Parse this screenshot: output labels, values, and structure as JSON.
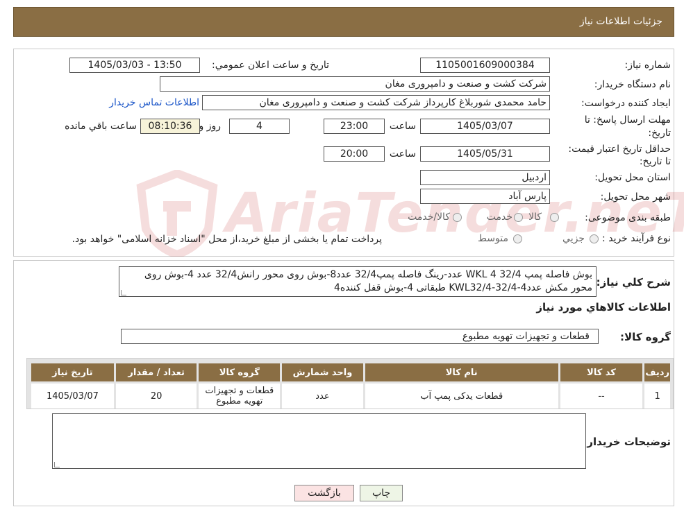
{
  "header": {
    "title": "جزئيات اطلاعات نياز"
  },
  "fields": {
    "need_number_label": "شماره نياز:",
    "need_number": "1105001609000384",
    "announce_label": "تاريخ و ساعت اعلان عمومي:",
    "announce_value": "1405/03/03 - 13:50",
    "buyer_org_label": "نام دستگاه خريدار:",
    "buyer_org": "شرکت کشت و صنعت و دامپروری مغان",
    "creator_label": "ايجاد کننده درخواست:",
    "creator": "حامد محمدی شوربلاغ کارپرداز شرکت کشت و صنعت و دامپروری مغان",
    "contact_link": "اطلاعات تماس خريدار",
    "deadline_label": "مهلت ارسال پاسخ: تا تاريخ:",
    "deadline_date": "1405/03/07",
    "time_label": "ساعت",
    "deadline_time": "23:00",
    "days_value": "4",
    "days_label": "روز و",
    "remaining_time": "08:10:36",
    "remaining_label": "ساعت باقي مانده",
    "validity_label": "حداقل تاريخ اعتبار قيمت: تا تاريخ:",
    "validity_date": "1405/05/31",
    "validity_time": "20:00",
    "province_label": "استان محل تحويل:",
    "province": "اردبيل",
    "city_label": "شهر محل تحويل:",
    "city": "پارس آباد",
    "category_label": "طبقه بندی موضوعی:",
    "category_options": [
      "کالا",
      "خدمت",
      "کالا/خدمت"
    ],
    "process_label": "نوع فرآيند خريد :",
    "process_options": [
      "جزيي",
      "متوسط"
    ],
    "process_note": "پرداخت تمام يا بخشی از مبلغ خريد،از محل \"اسناد خزانه اسلامی\" خواهد بود."
  },
  "description": {
    "label": "شرح کلي نياز:",
    "text": "بوش فاصله پمپ WKL 4 32/4 عدد-رینگ فاصله پمپ32/4 عدد8-بوش روی محور رانش32/4 عدد 4-بوش روی محور مکش عددKWL32/4-32/4-4 طبقاتی 4-بوش قفل کننده4"
  },
  "items_section_title": "اطلاعات کالاهاي مورد نياز",
  "group": {
    "label": "گروه کالا:",
    "value": "قطعات و تجهيزات تهويه مطبوع"
  },
  "table": {
    "headers": [
      "رديف",
      "کد کالا",
      "نام کالا",
      "واحد شمارش",
      "گروه کالا",
      "تعداد / مقدار",
      "تاريخ نياز"
    ],
    "rows": [
      [
        "1",
        "--",
        "قطعات یدکی پمپ آب",
        "عدد",
        "قطعات و تجهيزات تهويه مطبوع",
        "20",
        "1405/03/07"
      ]
    ]
  },
  "buyer_notes_label": "توضيحات خريدار:",
  "buttons": {
    "print": "چاپ",
    "back": "بازگشت"
  },
  "watermark": "AriaTender.neT",
  "colors": {
    "header_bg": "#8a6e44",
    "link": "#1a55c8"
  }
}
